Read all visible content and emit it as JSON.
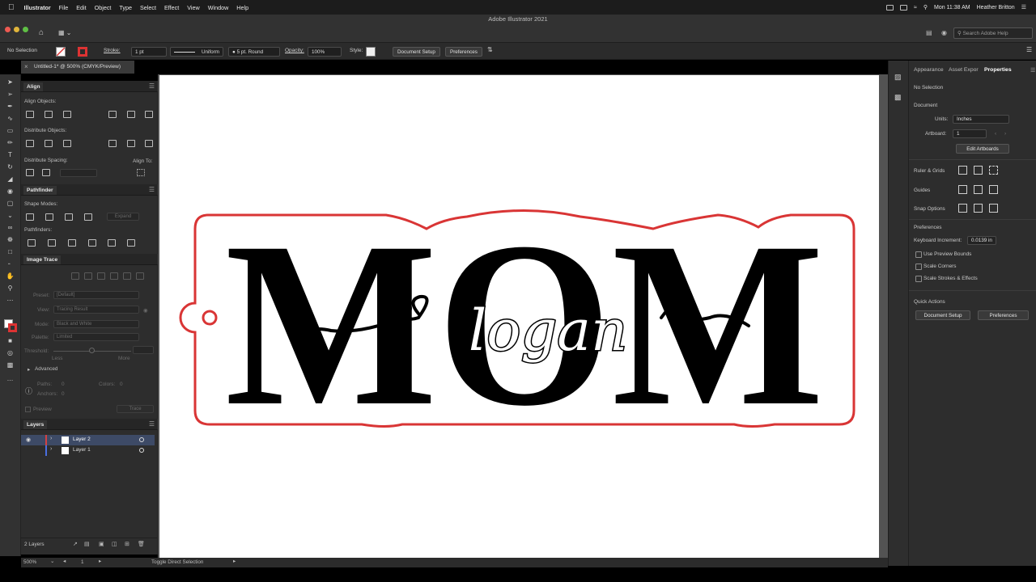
{
  "menubar": {
    "app": "Illustrator",
    "items": [
      "File",
      "Edit",
      "Object",
      "Type",
      "Select",
      "Effect",
      "View",
      "Window",
      "Help"
    ],
    "clock": "Mon 11:38 AM",
    "user": "Heather Britton"
  },
  "titlebar": {
    "title": "Adobe Illustrator 2021",
    "search_placeholder": "Search Adobe Help"
  },
  "controlbar": {
    "selection": "No Selection",
    "stroke_label": "Stroke:",
    "stroke_value": "1 pt",
    "profile": "Uniform",
    "brush": "5 pt. Round",
    "opacity_label": "Opacity:",
    "opacity_value": "100%",
    "style_label": "Style:",
    "document_setup": "Document Setup",
    "preferences": "Preferences"
  },
  "document_tab": {
    "title": "Untitled-1* @ 500% (CMYK/Preview)"
  },
  "align_panel": {
    "title": "Align",
    "align_objects": "Align Objects:",
    "distribute_objects": "Distribute Objects:",
    "distribute_spacing": "Distribute Spacing:",
    "align_to": "Align To:"
  },
  "pathfinder_panel": {
    "title": "Pathfinder",
    "shape_modes": "Shape Modes:",
    "expand": "Expand",
    "pathfinders": "Pathfinders:"
  },
  "image_trace_panel": {
    "title": "Image Trace",
    "preset_label": "Preset:",
    "preset_value": "[Default]",
    "view_label": "View:",
    "view_value": "Tracing Result",
    "mode_label": "Mode:",
    "mode_value": "Black and White",
    "palette_label": "Palette:",
    "palette_value": "Limited",
    "threshold_label": "Threshold:",
    "less": "Less",
    "more": "More",
    "advanced": "Advanced",
    "paths_label": "Paths:",
    "paths_value": "0",
    "colors_label": "Colors:",
    "colors_value": "0",
    "anchors_label": "Anchors:",
    "anchors_value": "0",
    "preview": "Preview",
    "trace": "Trace"
  },
  "layers_panel": {
    "title": "Layers",
    "layers": [
      {
        "name": "Layer 2",
        "color": "#d24242",
        "selected": true
      },
      {
        "name": "Layer 1",
        "color": "#4a6ee0",
        "selected": false
      }
    ],
    "count": "2 Layers"
  },
  "artwork": {
    "main_text": "MOM",
    "script_text": "logan",
    "outline_color": "#d93535",
    "fill_color": "#000000"
  },
  "statusbar": {
    "zoom": "500%",
    "artboard": "1",
    "tool_hint": "Toggle Direct Selection"
  },
  "properties_panel": {
    "tabs": [
      "Appearance",
      "Asset Expor",
      "Properties"
    ],
    "selection": "No Selection",
    "document_heading": "Document",
    "units_label": "Units:",
    "units_value": "Inches",
    "artboard_label": "Artboard:",
    "artboard_value": "1",
    "edit_artboards": "Edit Artboards",
    "ruler_grids": "Ruler & Grids",
    "guides": "Guides",
    "snap_options": "Snap Options",
    "preferences_heading": "Preferences",
    "keyboard_increment_label": "Keyboard Increment:",
    "keyboard_increment_value": "0.0139 in",
    "use_preview_bounds": "Use Preview Bounds",
    "scale_corners": "Scale Corners",
    "scale_strokes": "Scale Strokes & Effects",
    "quick_actions": "Quick Actions",
    "document_setup": "Document Setup",
    "preferences": "Preferences"
  }
}
